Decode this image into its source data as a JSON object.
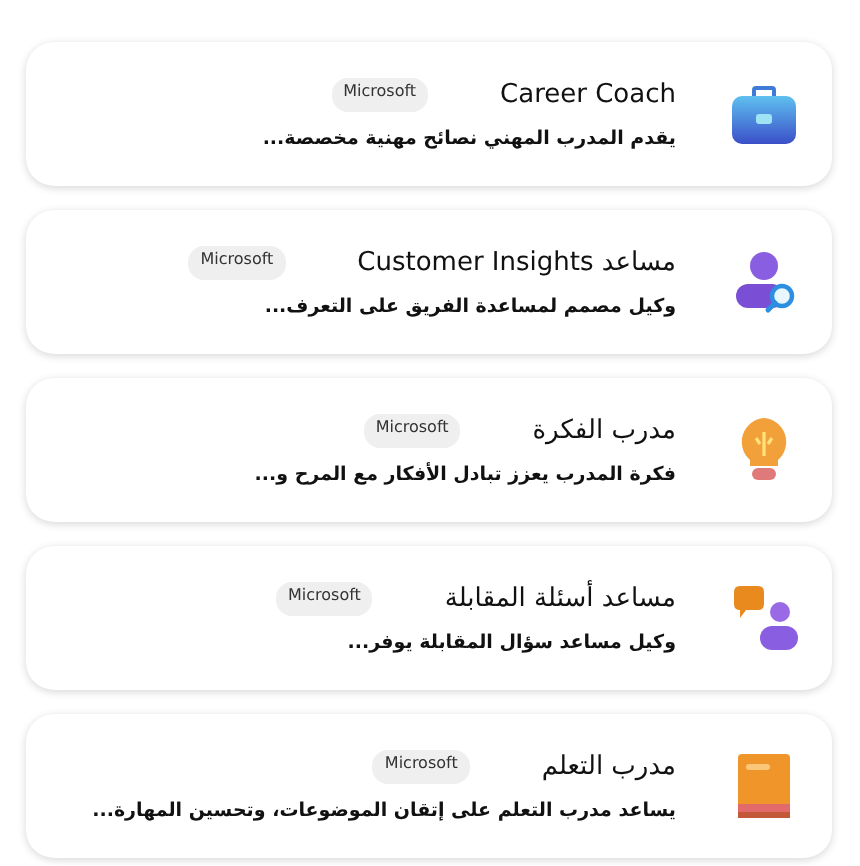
{
  "agents": [
    {
      "title": "Career Coach",
      "badge": "Microsoft",
      "description": "يقدم المدرب المهني نصائح مهنية مخصصة..."
    },
    {
      "title": "مساعد Customer Insights",
      "badge": "Microsoft",
      "description": "وكيل مصمم لمساعدة الفريق على التعرف..."
    },
    {
      "title": "مدرب الفكرة",
      "badge": "Microsoft",
      "description": "فكرة المدرب يعزز تبادل الأفكار مع المرح و..."
    },
    {
      "title": "مساعد أسئلة المقابلة",
      "badge": "Microsoft",
      "description": "وكيل مساعد سؤال المقابلة يوفر..."
    },
    {
      "title": "مدرب التعلم",
      "badge": "Microsoft",
      "description": "يساعد مدرب التعلم على إتقان الموضوعات، وتحسين المهارة..."
    }
  ]
}
